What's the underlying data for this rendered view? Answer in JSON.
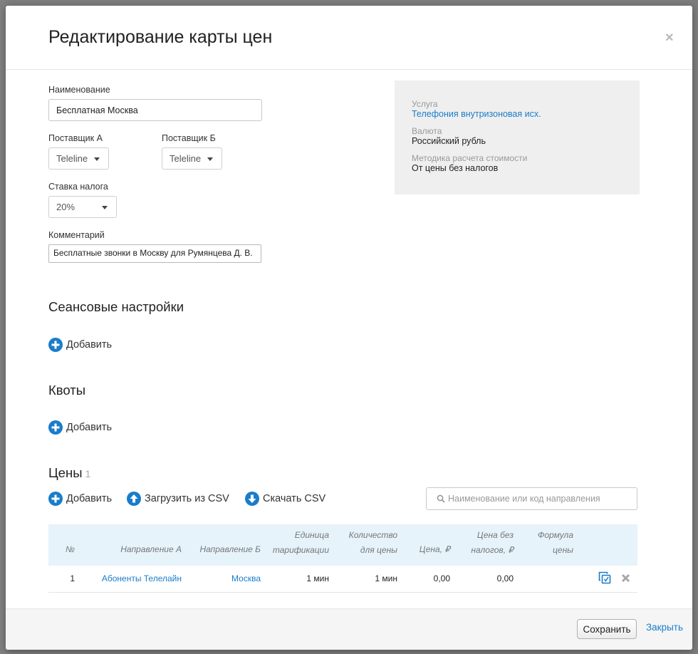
{
  "modal": {
    "title": "Редактирование карты цен",
    "close_symbol": "×"
  },
  "form": {
    "name_label": "Наименование",
    "name_value": "Бесплатная Москва",
    "supplier_a_label": "Поставщик А",
    "supplier_a_value": "Teleline",
    "supplier_b_label": "Поставщик Б",
    "supplier_b_value": "Teleline",
    "tax_label": "Ставка налога",
    "tax_value": "20%",
    "comment_label": "Комментарий",
    "comment_value": "Бесплатные звонки в Москву для Румянцева Д. В."
  },
  "info": {
    "service_label": "Услуга",
    "service_value": "Телефония внутризоновая исх.",
    "currency_label": "Валюта",
    "currency_value": "Российский рубль",
    "method_label": "Методика расчета стоимости",
    "method_value": "От цены без налогов"
  },
  "sessions": {
    "title": "Сеансовые настройки",
    "add_label": "Добавить"
  },
  "quotas": {
    "title": "Квоты",
    "add_label": "Добавить"
  },
  "prices": {
    "title": "Цены",
    "count": "1",
    "add_label": "Добавить",
    "upload_label": "Загрузить из CSV",
    "download_label": "Скачать CSV",
    "search_placeholder": "Наименование или код направления",
    "columns": {
      "num": "№",
      "dir_a": "Направление А",
      "dir_b": "Направление Б",
      "unit_1": "Единица",
      "unit_2": "тарификации",
      "qty_1": "Количество",
      "qty_2": "для цены",
      "price": "Цена, ₽",
      "net_1": "Цена без",
      "net_2": "налогов, ₽",
      "formula_1": "Формула",
      "formula_2": "цены"
    },
    "rows": [
      {
        "num": "1",
        "dir_a": "Абоненты Телелайн",
        "dir_b": "Москва",
        "unit": "1 мин",
        "qty": "1 мин",
        "price": "0,00",
        "net": "0,00",
        "formula": ""
      }
    ]
  },
  "footer": {
    "save_label": "Сохранить",
    "close_label": "Закрыть"
  },
  "colors": {
    "accent": "#1a7cc9",
    "table_header_bg": "#e6f3fb",
    "info_bg": "#efefef"
  },
  "icons": {
    "add": "plus-circle-icon",
    "upload": "arrow-up-circle-icon",
    "download": "arrow-down-circle-icon",
    "copy": "copy-icon",
    "delete": "close-icon",
    "search": "search-icon"
  }
}
